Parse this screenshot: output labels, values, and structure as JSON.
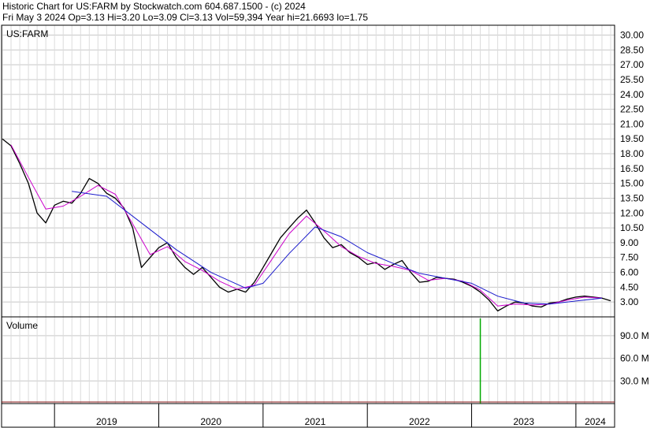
{
  "header": {
    "title": "Historic Chart for US:FARM by Stockwatch.com 604.687.1500 - (c) 2024",
    "quote": "Fri May  3 2024  Op=3.13  Hi=3.20  Lo=3.09  Cl=3.13  Vol=59,394  Year hi=21.6693  lo=1.75"
  },
  "chart_data": {
    "type": "line",
    "symbol_label": "US:FARM",
    "volume_label": "Volume",
    "x_ticks": [
      "2019",
      "2020",
      "2021",
      "2022",
      "2023",
      "2024"
    ],
    "price_ticks": [
      "30.00",
      "28.50",
      "27.00",
      "25.50",
      "24.00",
      "22.50",
      "21.00",
      "19.50",
      "18.00",
      "16.50",
      "15.00",
      "13.50",
      "12.00",
      "10.50",
      "9.00",
      "7.50",
      "6.00",
      "4.50",
      "3.00"
    ],
    "volume_ticks": [
      "90.0 M",
      "60.0 M",
      "30.0 M"
    ],
    "ylim": [
      1.5,
      31.0
    ],
    "volume_ylim": [
      0,
      115
    ],
    "grid": true,
    "series": [
      {
        "values": [
          [
            "2018-07",
            19.5
          ],
          [
            "2018-08",
            18.8
          ],
          [
            "2018-09",
            17.0
          ],
          [
            "2018-10",
            15.0
          ],
          [
            "2018-11",
            12.0
          ],
          [
            "2018-12",
            11.0
          ],
          [
            "2019-01",
            12.8
          ],
          [
            "2019-02",
            13.2
          ],
          [
            "2019-03",
            13.0
          ],
          [
            "2019-04",
            14.0
          ],
          [
            "2019-05",
            15.5
          ],
          [
            "2019-06",
            15.0
          ],
          [
            "2019-07",
            14.0
          ],
          [
            "2019-08",
            13.5
          ],
          [
            "2019-09",
            12.5
          ],
          [
            "2019-10",
            10.5
          ],
          [
            "2019-11",
            6.5
          ],
          [
            "2019-12",
            7.5
          ],
          [
            "2020-01",
            8.5
          ],
          [
            "2020-02",
            9.0
          ],
          [
            "2020-03",
            7.5
          ],
          [
            "2020-04",
            6.5
          ],
          [
            "2020-05",
            5.8
          ],
          [
            "2020-06",
            6.5
          ],
          [
            "2020-07",
            5.5
          ],
          [
            "2020-08",
            4.5
          ],
          [
            "2020-09",
            4.0
          ],
          [
            "2020-10",
            4.3
          ],
          [
            "2020-11",
            4.0
          ],
          [
            "2020-12",
            5.0
          ],
          [
            "2021-01",
            6.5
          ],
          [
            "2021-02",
            8.0
          ],
          [
            "2021-03",
            9.5
          ],
          [
            "2021-04",
            10.5
          ],
          [
            "2021-05",
            11.5
          ],
          [
            "2021-06",
            12.3
          ],
          [
            "2021-07",
            11.0
          ],
          [
            "2021-08",
            9.5
          ],
          [
            "2021-09",
            8.5
          ],
          [
            "2021-10",
            8.8
          ],
          [
            "2021-11",
            8.0
          ],
          [
            "2021-12",
            7.5
          ],
          [
            "2022-01",
            6.8
          ],
          [
            "2022-02",
            7.0
          ],
          [
            "2022-03",
            6.3
          ],
          [
            "2022-04",
            6.8
          ],
          [
            "2022-05",
            7.2
          ],
          [
            "2022-06",
            6.0
          ],
          [
            "2022-07",
            5.0
          ],
          [
            "2022-08",
            5.1
          ],
          [
            "2022-09",
            5.5
          ],
          [
            "2022-10",
            5.4
          ],
          [
            "2022-11",
            5.3
          ],
          [
            "2022-12",
            5.0
          ],
          [
            "2023-01",
            4.6
          ],
          [
            "2023-02",
            4.0
          ],
          [
            "2023-03",
            3.2
          ],
          [
            "2023-04",
            2.1
          ],
          [
            "2023-05",
            2.6
          ],
          [
            "2023-06",
            3.0
          ],
          [
            "2023-07",
            2.9
          ],
          [
            "2023-08",
            2.6
          ],
          [
            "2023-09",
            2.5
          ],
          [
            "2023-10",
            2.9
          ],
          [
            "2023-11",
            3.0
          ],
          [
            "2023-12",
            3.3
          ],
          [
            "2024-01",
            3.5
          ],
          [
            "2024-02",
            3.6
          ],
          [
            "2024-03",
            3.5
          ],
          [
            "2024-04",
            3.4
          ],
          [
            "2024-05",
            3.13
          ]
        ]
      },
      {
        "values": [
          [
            "2018-08",
            18.9
          ],
          [
            "2018-10",
            15.6
          ],
          [
            "2018-12",
            12.4
          ],
          [
            "2019-02",
            12.7
          ],
          [
            "2019-04",
            13.7
          ],
          [
            "2019-06",
            14.8
          ],
          [
            "2019-08",
            13.9
          ],
          [
            "2019-10",
            10.9
          ],
          [
            "2019-12",
            7.8
          ],
          [
            "2020-02",
            8.6
          ],
          [
            "2020-04",
            7.1
          ],
          [
            "2020-06",
            6.2
          ],
          [
            "2020-08",
            5.1
          ],
          [
            "2020-10",
            4.3
          ],
          [
            "2020-12",
            4.7
          ],
          [
            "2021-02",
            7.3
          ],
          [
            "2021-04",
            9.9
          ],
          [
            "2021-06",
            11.7
          ],
          [
            "2021-08",
            10.2
          ],
          [
            "2021-10",
            8.6
          ],
          [
            "2021-12",
            7.6
          ],
          [
            "2022-02",
            6.9
          ],
          [
            "2022-04",
            6.6
          ],
          [
            "2022-06",
            6.2
          ],
          [
            "2022-08",
            5.2
          ],
          [
            "2022-10",
            5.4
          ],
          [
            "2022-12",
            5.1
          ],
          [
            "2023-02",
            4.2
          ],
          [
            "2023-04",
            2.6
          ],
          [
            "2023-06",
            2.8
          ],
          [
            "2023-08",
            2.7
          ],
          [
            "2023-10",
            2.8
          ],
          [
            "2023-12",
            3.2
          ],
          [
            "2024-02",
            3.5
          ],
          [
            "2024-04",
            3.4
          ]
        ]
      },
      {
        "values": [
          [
            "2019-03",
            14.2
          ],
          [
            "2019-07",
            13.7
          ],
          [
            "2019-11",
            11.0
          ],
          [
            "2020-03",
            8.3
          ],
          [
            "2020-07",
            6.0
          ],
          [
            "2020-11",
            4.4
          ],
          [
            "2021-01",
            4.9
          ],
          [
            "2021-04",
            7.9
          ],
          [
            "2021-07",
            10.6
          ],
          [
            "2021-10",
            9.6
          ],
          [
            "2022-01",
            8.0
          ],
          [
            "2022-04",
            6.9
          ],
          [
            "2022-07",
            5.9
          ],
          [
            "2022-10",
            5.4
          ],
          [
            "2023-01",
            4.9
          ],
          [
            "2023-04",
            3.6
          ],
          [
            "2023-07",
            2.9
          ],
          [
            "2023-10",
            2.8
          ],
          [
            "2024-01",
            3.1
          ],
          [
            "2024-04",
            3.4
          ]
        ]
      }
    ],
    "volume": [
      [
        "2023-02",
        113
      ]
    ]
  }
}
